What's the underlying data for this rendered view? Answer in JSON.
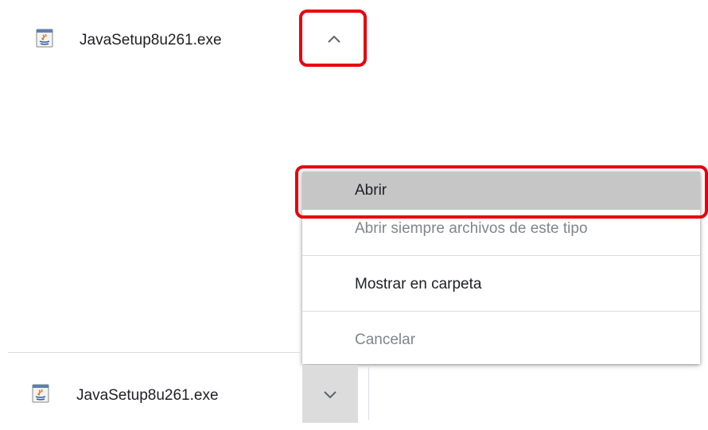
{
  "top_item": {
    "file_name": "JavaSetup8u261.exe",
    "icon": "java-file-icon",
    "chevron": "chevron-up-icon"
  },
  "context_menu": {
    "items": [
      {
        "label": "Abrir",
        "state": "hovered"
      },
      {
        "label": "Abrir siempre archivos de este tipo",
        "state": "disabled"
      },
      {
        "label": "Mostrar en carpeta",
        "state": "normal"
      },
      {
        "label": "Cancelar",
        "state": "disabled"
      }
    ]
  },
  "download_shelf": {
    "file_name": "JavaSetup8u261.exe",
    "icon": "java-file-icon",
    "chevron": "chevron-down-icon"
  },
  "colors": {
    "highlight": "#e8000d",
    "hover_bg": "#c6c6c6",
    "disabled_text": "#80868b"
  }
}
